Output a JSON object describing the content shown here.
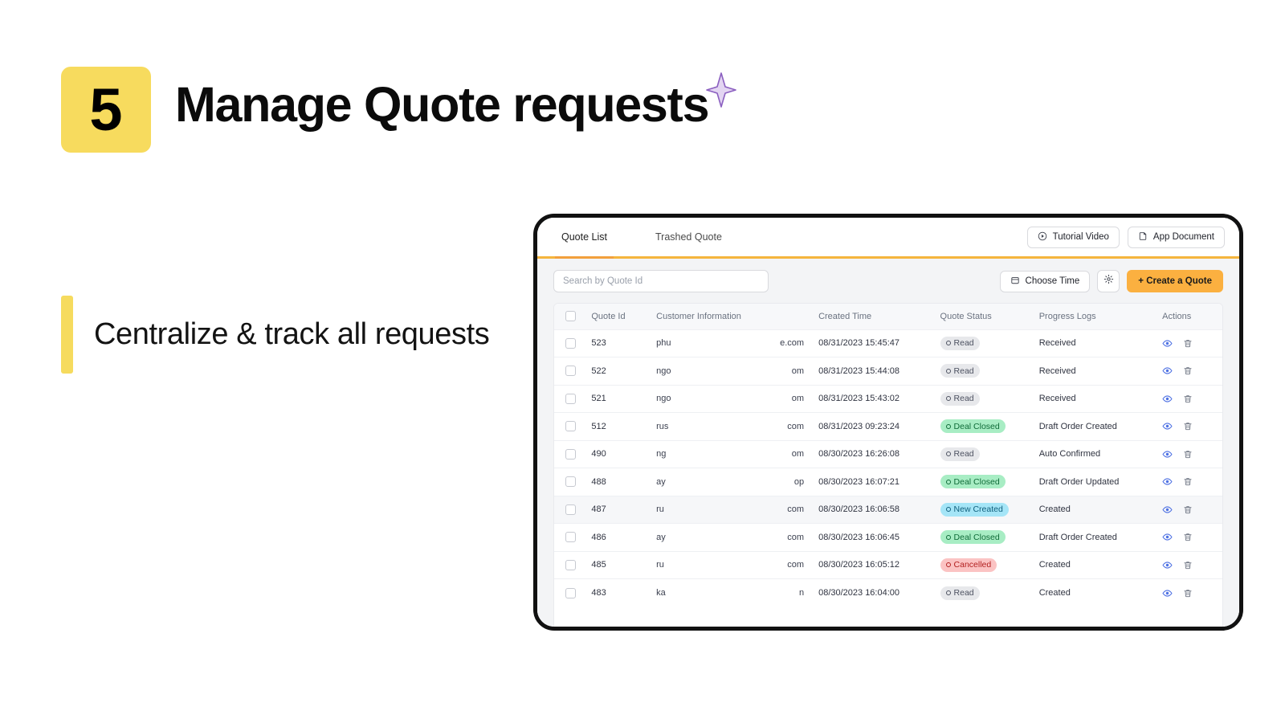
{
  "slide": {
    "step_number": "5",
    "title": "Manage Quote requests",
    "sparkle_icon": "sparkle-icon",
    "subtitle": "Centralize & track all requests",
    "accent_color": "#F7DB5E"
  },
  "app": {
    "tabs": [
      {
        "label": "Quote List",
        "active": true
      },
      {
        "label": "Trashed Quote",
        "active": false
      }
    ],
    "tab_actions": [
      {
        "label": "Tutorial Video",
        "icon": "play-circle-icon"
      },
      {
        "label": "App Document",
        "icon": "document-icon"
      }
    ],
    "toolbar": {
      "search_placeholder": "Search by Quote Id",
      "search_value": "",
      "choose_time_label": "Choose Time",
      "choose_time_icon": "calendar-icon",
      "settings_icon": "gear-icon",
      "create_label": "+ Create a Quote",
      "create_color": "#FBB040"
    },
    "table": {
      "columns": [
        "",
        "Quote Id",
        "Customer Information",
        "Created Time",
        "Quote Status",
        "Progress Logs",
        "Actions"
      ],
      "rows": [
        {
          "id": "523",
          "cust_a": "phu",
          "cust_b": "e.com",
          "time": "08/31/2023 15:45:47",
          "status": "Read",
          "status_color": "gray",
          "progress": "Received",
          "highlight": false
        },
        {
          "id": "522",
          "cust_a": "ngo",
          "cust_b": "om",
          "time": "08/31/2023 15:44:08",
          "status": "Read",
          "status_color": "gray",
          "progress": "Received",
          "highlight": false
        },
        {
          "id": "521",
          "cust_a": "ngo",
          "cust_b": "om",
          "time": "08/31/2023 15:43:02",
          "status": "Read",
          "status_color": "gray",
          "progress": "Received",
          "highlight": false
        },
        {
          "id": "512",
          "cust_a": "rus",
          "cust_b": "com",
          "time": "08/31/2023 09:23:24",
          "status": "Deal Closed",
          "status_color": "green",
          "progress": "Draft Order Created",
          "highlight": false
        },
        {
          "id": "490",
          "cust_a": "ng",
          "cust_b": "om",
          "time": "08/30/2023 16:26:08",
          "status": "Read",
          "status_color": "gray",
          "progress": "Auto Confirmed",
          "highlight": false
        },
        {
          "id": "488",
          "cust_a": "ay",
          "cust_b": "op",
          "time": "08/30/2023 16:07:21",
          "status": "Deal Closed",
          "status_color": "green",
          "progress": "Draft Order Updated",
          "highlight": false
        },
        {
          "id": "487",
          "cust_a": "ru",
          "cust_b": "com",
          "time": "08/30/2023 16:06:58",
          "status": "New Created",
          "status_color": "blue",
          "progress": "Created",
          "highlight": true
        },
        {
          "id": "486",
          "cust_a": "ay",
          "cust_b": "com",
          "time": "08/30/2023 16:06:45",
          "status": "Deal Closed",
          "status_color": "green",
          "progress": "Draft Order Created",
          "highlight": false
        },
        {
          "id": "485",
          "cust_a": "ru",
          "cust_b": "com",
          "time": "08/30/2023 16:05:12",
          "status": "Cancelled",
          "status_color": "red",
          "progress": "Created",
          "highlight": false
        },
        {
          "id": "483",
          "cust_a": "ka",
          "cust_b": "n",
          "time": "08/30/2023 16:04:00",
          "status": "Read",
          "status_color": "gray",
          "progress": "Created",
          "highlight": false
        }
      ],
      "row_actions": [
        {
          "icon": "eye-icon",
          "color": "#4F72E3"
        },
        {
          "icon": "trash-icon",
          "color": "#6b7280"
        }
      ]
    }
  }
}
